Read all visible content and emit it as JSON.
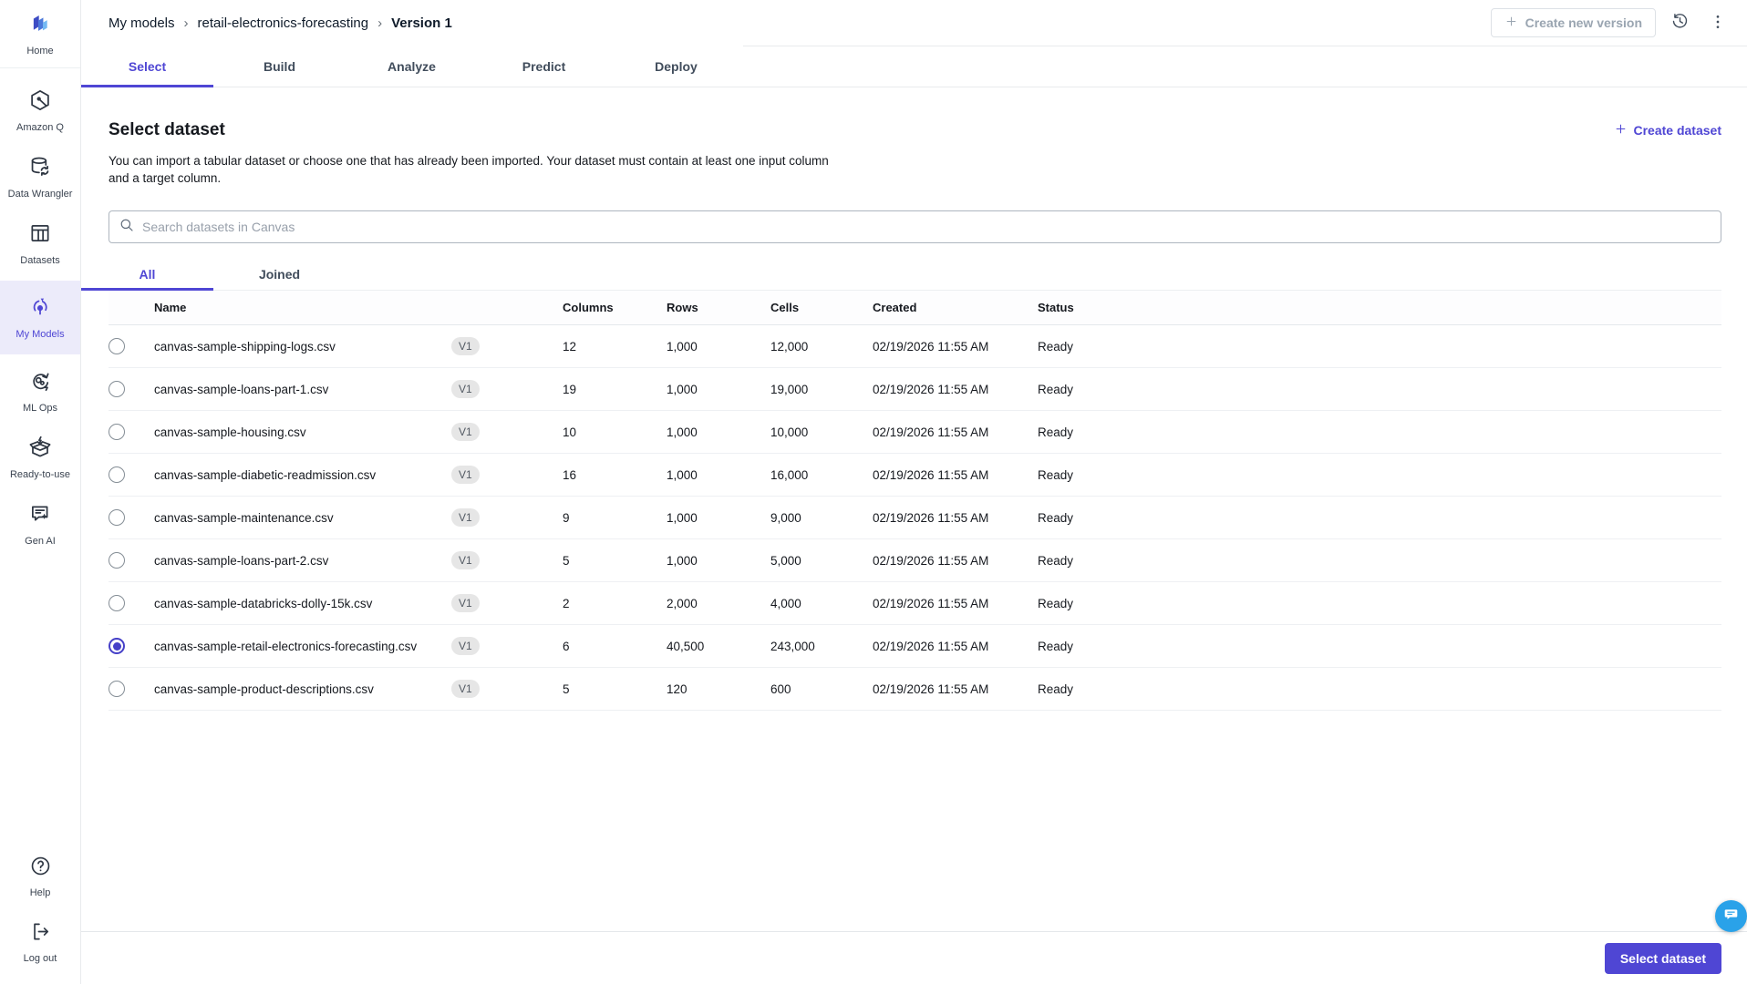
{
  "colors": {
    "accent": "#4f46d4",
    "accent_bg": "#ecebfa",
    "chat_blue": "#2aa2e9"
  },
  "sidebar": {
    "items": [
      {
        "label": "Home"
      },
      {
        "label": "Amazon Q"
      },
      {
        "label": "Data Wrangler"
      },
      {
        "label": "Datasets"
      },
      {
        "label": "My Models",
        "active": true
      },
      {
        "label": "ML Ops"
      },
      {
        "label": "Ready-to-use"
      },
      {
        "label": "Gen AI"
      },
      {
        "label": "Help"
      },
      {
        "label": "Log out"
      }
    ]
  },
  "topbar": {
    "breadcrumb": [
      "My models",
      "retail-electronics-forecasting",
      "Version 1"
    ],
    "create_new_version_label": "Create new version"
  },
  "tabs": {
    "items": [
      "Select",
      "Build",
      "Analyze",
      "Predict",
      "Deploy"
    ],
    "active": "Select"
  },
  "main": {
    "title": "Select dataset",
    "description_lines": [
      "You can import a tabular dataset or choose one that has already been imported. Your dataset must contain at least one input column",
      "and a target column."
    ],
    "create_dataset_label": "Create dataset",
    "search_placeholder": "Search datasets in Canvas",
    "filter_tabs": [
      "All",
      "Joined"
    ],
    "active_filter": "All",
    "table": {
      "headers": [
        "Name",
        "Columns",
        "Rows",
        "Cells",
        "Created",
        "Status"
      ],
      "rows": [
        {
          "name": "canvas-sample-shipping-logs.csv",
          "version": "V1",
          "columns": "12",
          "rows": "1,000",
          "cells": "12,000",
          "created": "02/19/2026 11:55 AM",
          "status": "Ready",
          "selected": false
        },
        {
          "name": "canvas-sample-loans-part-1.csv",
          "version": "V1",
          "columns": "19",
          "rows": "1,000",
          "cells": "19,000",
          "created": "02/19/2026 11:55 AM",
          "status": "Ready",
          "selected": false
        },
        {
          "name": "canvas-sample-housing.csv",
          "version": "V1",
          "columns": "10",
          "rows": "1,000",
          "cells": "10,000",
          "created": "02/19/2026 11:55 AM",
          "status": "Ready",
          "selected": false
        },
        {
          "name": "canvas-sample-diabetic-readmission.csv",
          "version": "V1",
          "columns": "16",
          "rows": "1,000",
          "cells": "16,000",
          "created": "02/19/2026 11:55 AM",
          "status": "Ready",
          "selected": false
        },
        {
          "name": "canvas-sample-maintenance.csv",
          "version": "V1",
          "columns": "9",
          "rows": "1,000",
          "cells": "9,000",
          "created": "02/19/2026 11:55 AM",
          "status": "Ready",
          "selected": false
        },
        {
          "name": "canvas-sample-loans-part-2.csv",
          "version": "V1",
          "columns": "5",
          "rows": "1,000",
          "cells": "5,000",
          "created": "02/19/2026 11:55 AM",
          "status": "Ready",
          "selected": false
        },
        {
          "name": "canvas-sample-databricks-dolly-15k.csv",
          "version": "V1",
          "columns": "2",
          "rows": "2,000",
          "cells": "4,000",
          "created": "02/19/2026 11:55 AM",
          "status": "Ready",
          "selected": false
        },
        {
          "name": "canvas-sample-retail-electronics-forecasting.csv",
          "version": "V1",
          "columns": "6",
          "rows": "40,500",
          "cells": "243,000",
          "created": "02/19/2026 11:55 AM",
          "status": "Ready",
          "selected": true
        },
        {
          "name": "canvas-sample-product-descriptions.csv",
          "version": "V1",
          "columns": "5",
          "rows": "120",
          "cells": "600",
          "created": "02/19/2026 11:55 AM",
          "status": "Ready",
          "selected": false
        }
      ]
    }
  },
  "footer": {
    "select_dataset_label": "Select dataset"
  }
}
